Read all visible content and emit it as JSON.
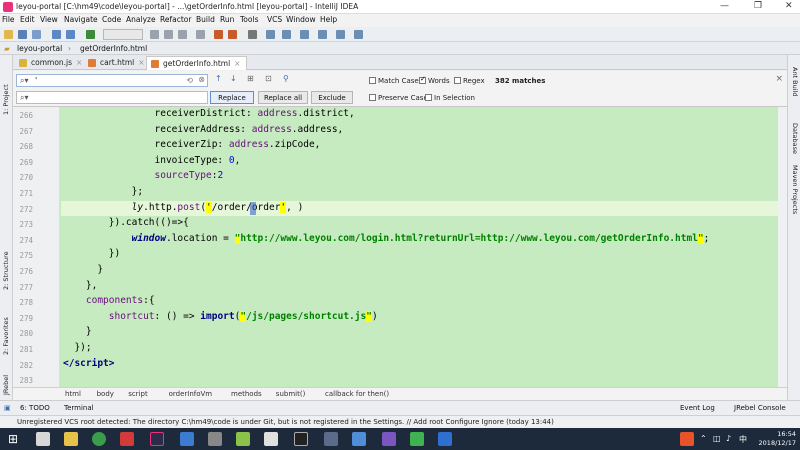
{
  "window": {
    "title": "leyou-portal [C:\\hm49\\code\\leyou-portal] - ...\\getOrderInfo.html [leyou-portal] - IntelliJ IDEA"
  },
  "menu": [
    "File",
    "Edit",
    "View",
    "Navigate",
    "Code",
    "Analyze",
    "Refactor",
    "Build",
    "Run",
    "Tools",
    "VCS",
    "Window",
    "Help"
  ],
  "nav": {
    "project": "leyou-portal",
    "file": "getOrderInfo.html"
  },
  "tabs": [
    {
      "label": "common.js",
      "active": false
    },
    {
      "label": "cart.html",
      "active": false
    },
    {
      "label": "getOrderInfo.html",
      "active": true
    }
  ],
  "find": {
    "search_value": "'",
    "search_icon": "search-icon",
    "replace_value": "",
    "replace_label": "Replace",
    "replace_all_label": "Replace all",
    "exclude_label": "Exclude",
    "match_case": "Match Case",
    "words": "Words",
    "regex": "Regex",
    "matches": "382 matches",
    "preserve_case": "Preserve Case",
    "in_selection": "In Selection"
  },
  "editor": {
    "lines": [
      {
        "n": "266",
        "html": "                receiverDistrict: <span class='pr'>address</span>.district,"
      },
      {
        "n": "267",
        "html": "                receiverAddress: <span class='pr'>address</span>.address,"
      },
      {
        "n": "268",
        "html": "                receiverZip: <span class='pr'>address</span>.zipCode,"
      },
      {
        "n": "269",
        "html": "                invoiceType: <span class='n'>0</span>,"
      },
      {
        "n": "270",
        "html": "                <span class='pr'>sourceType</span>:<span class='n'>2</span>"
      },
      {
        "n": "271",
        "html": "            };"
      },
      {
        "n": "272",
        "html": "            <span class='i'>ly</span>.http.<span class='pr'>post</span>(<span class='hl'>'</span>/order/order<span class='hl'>'</span>, )"
      },
      {
        "n": "273",
        "html": "        }).catch(()=>{"
      },
      {
        "n": "274",
        "html": "            <span class='i k'>window</span>.location = <span class='s'><span class='hl'>\"</span>http://www.leyou.com/login.html?returnUrl=http://www.leyou.com/getOrderInfo.html<span class='hl'>\"</span></span>;"
      },
      {
        "n": "275",
        "html": "        })"
      },
      {
        "n": "276",
        "html": "      }"
      },
      {
        "n": "277",
        "html": "    },"
      },
      {
        "n": "278",
        "html": "    <span class='pr'>components</span>:{"
      },
      {
        "n": "279",
        "html": "        <span class='pr'>shortcut</span>: () => <span class='k'>import</span>(<span class='s'><span class='hl'>\"</span>/js/pages/shortcut.js<span class='hl'>\"</span></span>)"
      },
      {
        "n": "280",
        "html": "    }"
      },
      {
        "n": "281",
        "html": "  });"
      },
      {
        "n": "282",
        "html": "<span class='k'>&lt;/script&gt;</span>"
      },
      {
        "n": "283",
        "html": ""
      }
    ]
  },
  "breadcrumbs": [
    "html",
    "body",
    "script",
    "orderInfoVm",
    "methods",
    "submit()",
    "callback for then()"
  ],
  "left_tools": [
    "1: Project",
    "2: Structure",
    "2: Favorites",
    "JRebel"
  ],
  "right_tools": [
    "Ant Build",
    "Database",
    "Maven Projects"
  ],
  "bottom_tools": {
    "todo": "6: TODO",
    "terminal": "Terminal",
    "event_log": "Event Log",
    "jrebel": "JRebel Console"
  },
  "status": "Unregistered VCS root detected: The directory C:\\hm49\\code is under Git, but is not registered in the Settings. // Add root  Configure  Ignore (today 13:44)",
  "clock": {
    "time": "16:54",
    "date": "2018/12/17"
  },
  "colors": {
    "editor_bg": "#c7ebc0",
    "taskbar": "#1c2a3b",
    "highlight": "#ffff00"
  }
}
